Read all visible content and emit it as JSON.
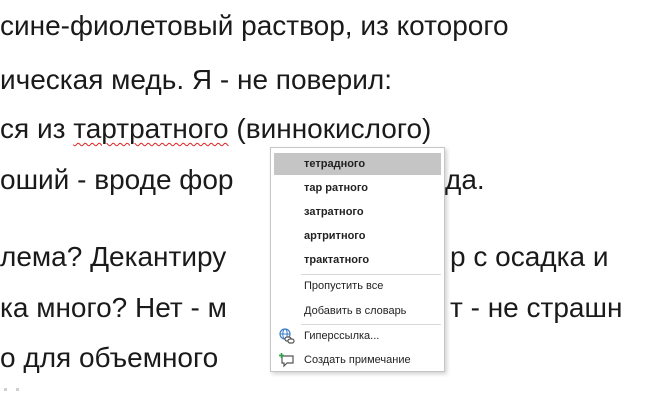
{
  "document": {
    "lines": [
      "сине-фиолетовый раствор, из которого",
      "ическая медь. Я - не поверил:",
      "ся из ",
      "тартратного",
      " (виннокислого)",
      "оший - вроде фор",
      "да.",
      "лема? Декантиру",
      "р с осадка и",
      "ка много? Нет - м",
      "т - не страшн",
      "о для объемного"
    ]
  },
  "context_menu": {
    "suggestions": [
      "тетрадного",
      "тар ратного",
      "затратного",
      "артритного",
      "трактатного"
    ],
    "ignore_all": "Пропустить все",
    "add_to_dictionary": "Добавить в словарь",
    "hyperlink": "Гиперссылка...",
    "new_comment": "Создать примечание",
    "icons": {
      "hyperlink": "link-globe-icon",
      "new_comment": "new-comment-icon"
    },
    "selected_index": 0,
    "colors": {
      "selected_bg": "#c5c5c5",
      "border": "#c6c6c6",
      "spell_underline": "#e02020"
    }
  }
}
